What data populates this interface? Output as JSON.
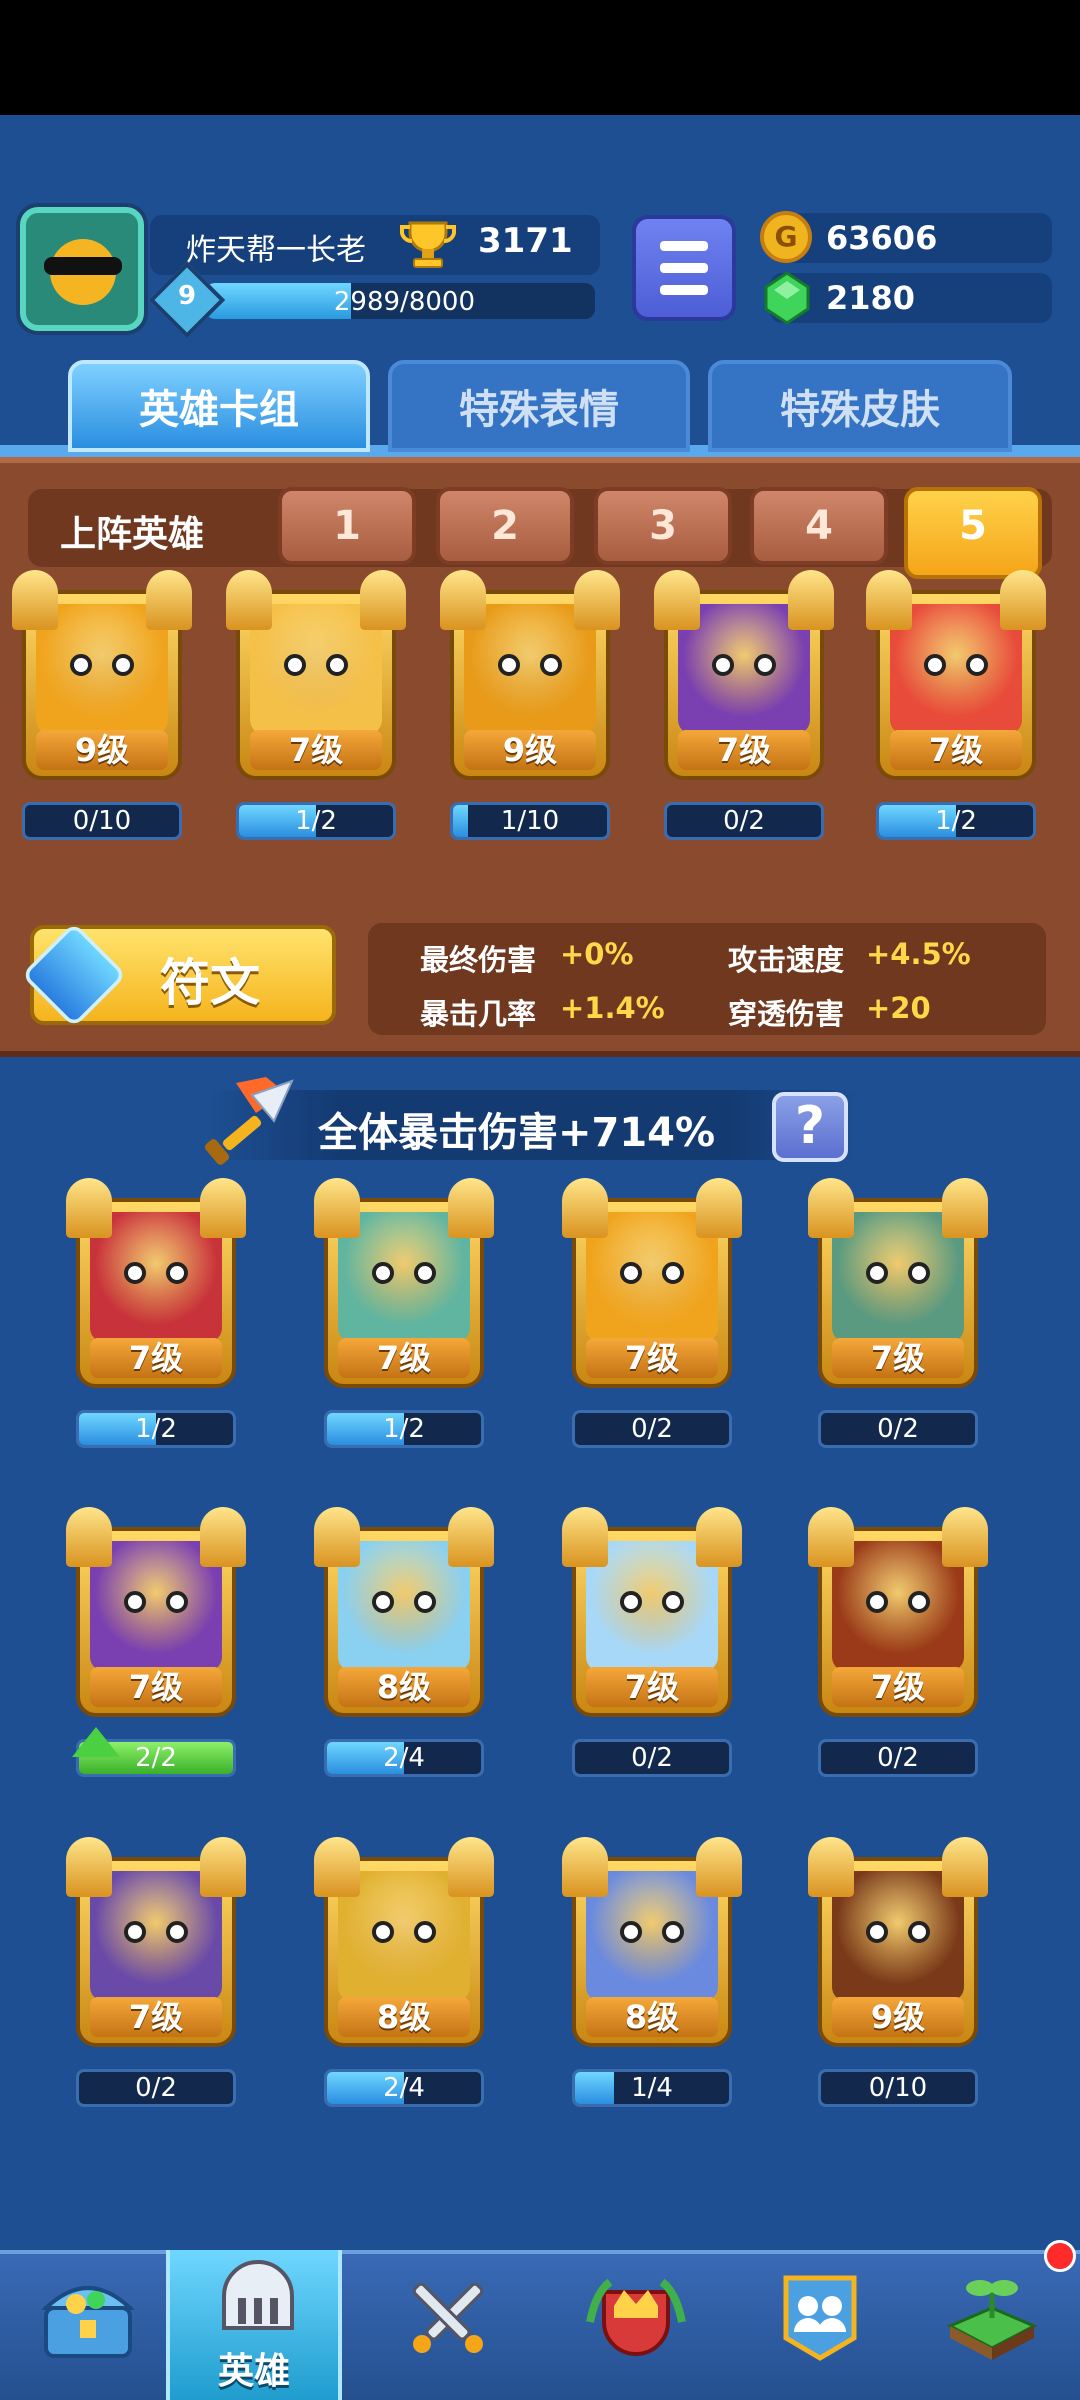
{
  "player": {
    "name": "炸天帮一长老",
    "trophies": "3171",
    "level": "9",
    "xp": "2989/8000",
    "xp_fraction": 0.374
  },
  "currency": {
    "coins": "63606",
    "gems": "2180"
  },
  "tabs": [
    {
      "label": "英雄卡组",
      "active": true
    },
    {
      "label": "特殊表情",
      "active": false
    },
    {
      "label": "特殊皮肤",
      "active": false
    }
  ],
  "deck": {
    "label": "上阵英雄",
    "slots": [
      "1",
      "2",
      "3",
      "4",
      "5"
    ],
    "active_slot": "5",
    "heroes": [
      {
        "level": "9级",
        "progress": "0/10",
        "fill": 0.0,
        "color": "#f0a41e"
      },
      {
        "level": "7级",
        "progress": "1/2",
        "fill": 0.5,
        "color": "#f5c048"
      },
      {
        "level": "9级",
        "progress": "1/10",
        "fill": 0.1,
        "color": "#e89a18"
      },
      {
        "level": "7级",
        "progress": "0/2",
        "fill": 0.0,
        "color": "#7a3fb0"
      },
      {
        "level": "7级",
        "progress": "1/2",
        "fill": 0.5,
        "color": "#e84b3a"
      }
    ]
  },
  "rune": {
    "label": "符文"
  },
  "stats": [
    {
      "name": "最终伤害",
      "value": "+0%"
    },
    {
      "name": "攻击速度",
      "value": "+4.5%"
    },
    {
      "name": "暴击几率",
      "value": "+1.4%"
    },
    {
      "name": "穿透伤害",
      "value": "+20"
    }
  ],
  "banner": {
    "text": "全体暴击伤害+714%",
    "help": "?"
  },
  "collection": [
    {
      "level": "7级",
      "progress": "1/2",
      "fill": 0.5,
      "color": "#c8323a"
    },
    {
      "level": "7级",
      "progress": "1/2",
      "fill": 0.5,
      "color": "#5fb5a0"
    },
    {
      "level": "7级",
      "progress": "0/2",
      "fill": 0.0,
      "color": "#f0a41e"
    },
    {
      "level": "7级",
      "progress": "0/2",
      "fill": 0.0,
      "color": "#5a9a80"
    },
    {
      "level": "7级",
      "progress": "2/2",
      "fill": 1.0,
      "color": "#7a3fb0",
      "upgrade": true
    },
    {
      "level": "8级",
      "progress": "2/4",
      "fill": 0.5,
      "color": "#8ad0f0"
    },
    {
      "level": "7级",
      "progress": "0/2",
      "fill": 0.0,
      "color": "#a8d8f8"
    },
    {
      "level": "7级",
      "progress": "0/2",
      "fill": 0.0,
      "color": "#9a3a18"
    },
    {
      "level": "7级",
      "progress": "0/2",
      "fill": 0.0,
      "color": "#6a4aa8"
    },
    {
      "level": "8级",
      "progress": "2/4",
      "fill": 0.5,
      "color": "#e0b030"
    },
    {
      "level": "8级",
      "progress": "1/4",
      "fill": 0.25,
      "color": "#6a8ae0"
    },
    {
      "level": "9级",
      "progress": "0/10",
      "fill": 0.0,
      "color": "#7a3a1a"
    }
  ],
  "nav": [
    {
      "icon": "treasure-chest-icon",
      "label": ""
    },
    {
      "icon": "helmet-icon",
      "label": "英雄",
      "active": true
    },
    {
      "icon": "crossed-swords-icon",
      "label": ""
    },
    {
      "icon": "crown-shield-icon",
      "label": ""
    },
    {
      "icon": "friends-icon",
      "label": ""
    },
    {
      "icon": "sprout-icon",
      "label": ""
    }
  ]
}
